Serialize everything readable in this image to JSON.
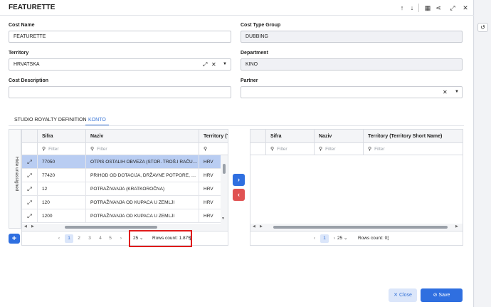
{
  "window": {
    "title": "FEATURETTE",
    "toolbar_icons": [
      "arrow-up-icon",
      "arrow-down-icon",
      "grid-icon",
      "share-icon",
      "expand-icon",
      "close-icon"
    ]
  },
  "form": {
    "cost_name": {
      "label": "Cost Name",
      "value": "FEATURETTE"
    },
    "cost_type_group": {
      "label": "Cost Type Group",
      "value": "DUBBING"
    },
    "territory": {
      "label": "Territory",
      "value": "HRVATSKA"
    },
    "department": {
      "label": "Department",
      "value": "KINO"
    },
    "cost_description": {
      "label": "Cost Description",
      "value": ""
    },
    "partner": {
      "label": "Partner",
      "value": ""
    }
  },
  "tabs": [
    "STUDIO ROYALTY DEFINITION",
    "KONTO"
  ],
  "active_tab": "KONTO",
  "sidebar": {
    "label": "Hide unassigned"
  },
  "left_grid": {
    "columns": [
      "Sifra",
      "Naziv",
      "Territory (Te"
    ],
    "filter_placeholder": "Filter",
    "rows": [
      {
        "sifra": "77050",
        "naziv": "OTPIS OSTALIH OBVEZA (STOR. TROŠ.I RAČU. I...",
        "territory": "HRV"
      },
      {
        "sifra": "77420",
        "naziv": "PRIHOD OD DOTACIJA, DRŽAVNE POTPORE, SU...",
        "territory": "HRV"
      },
      {
        "sifra": "12",
        "naziv": "POTRAŽIVANJA (KRATKOROČNA)",
        "territory": "HRV"
      },
      {
        "sifra": "120",
        "naziv": "POTRAŽIVANJA OD KUPACA U ZEMLJI",
        "territory": "HRV"
      },
      {
        "sifra": "1200",
        "naziv": "POTRAŽIVANJA OD KUPACA U ZEMLJI",
        "territory": "HRV"
      }
    ],
    "pages": [
      "1",
      "2",
      "3",
      "4",
      "5"
    ],
    "page_size": "25",
    "rows_count": "Rows count: 1.875"
  },
  "right_grid": {
    "columns": [
      "Sifra",
      "Naziv",
      "Territory (Territory Short Name)"
    ],
    "filter_placeholder": "Filter",
    "pages": [
      "1"
    ],
    "page_size": "25",
    "rows_count": "Rows count: 0"
  },
  "buttons": {
    "close": "Close",
    "save": "Save"
  },
  "colors": {
    "primary": "#2f6fe0",
    "danger": "#e05252",
    "highlight": "#e01b1b",
    "selected_row": "#b9cdf2"
  }
}
